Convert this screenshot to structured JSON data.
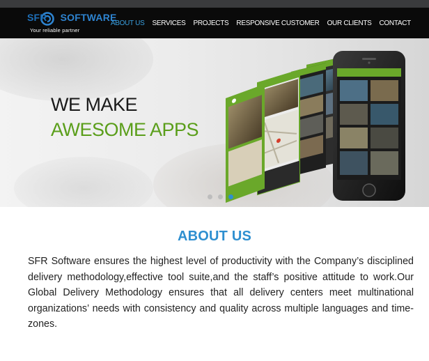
{
  "logo": {
    "brand_left": "SFR",
    "brand_right": "SOFTWARE",
    "tagline": "Your reliable partner"
  },
  "nav": {
    "items": [
      {
        "label": "ABOUT US",
        "active": true
      },
      {
        "label": "SERVICES",
        "active": false
      },
      {
        "label": "PROJECTS",
        "active": false
      },
      {
        "label": "RESPONSIVE CUSTOMER",
        "active": false
      },
      {
        "label": "OUR CLIENTS",
        "active": false
      },
      {
        "label": "CONTACT",
        "active": false
      }
    ]
  },
  "hero": {
    "line1": "WE MAKE",
    "line2": "AWESOME APPS",
    "slides": 3,
    "active_slide": 3
  },
  "about": {
    "title": "ABOUT US",
    "body": "SFR Software ensures the highest level of productivity with the Company’s disciplined delivery methodology,effective tool suite,and the staff’s positive attitude to work.Our Global Delivery Methodology ensures that all delivery centers meet multinational organizations’ needs with consistency and quality across multiple languages and time-zones."
  },
  "colors": {
    "accent_blue": "#2e8fd0",
    "accent_green": "#5a9e1a",
    "navbar_bg": "#0a0a0a"
  }
}
